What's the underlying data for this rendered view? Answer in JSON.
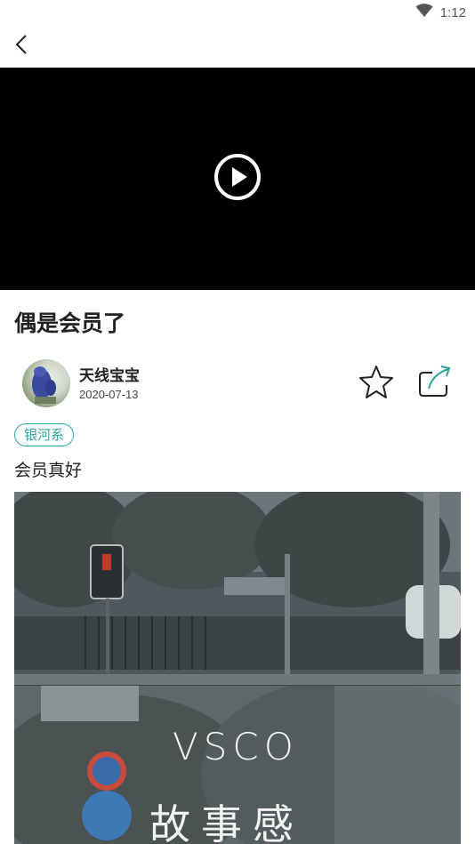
{
  "status_bar": {
    "time": "1:12",
    "wifi_icon": "wifi-icon"
  },
  "nav": {
    "back_icon": "back-arrow-icon"
  },
  "video": {
    "play_icon": "play-icon"
  },
  "post": {
    "title": "偶是会员了",
    "author_name": "天线宝宝",
    "date": "2020-07-13",
    "tag": "银河系",
    "body": "会员真好",
    "image_overlay": {
      "line1": "VSCO",
      "line2": "故事感"
    }
  },
  "actions": {
    "favorite_icon": "star-icon",
    "share_icon": "share-icon"
  },
  "colors": {
    "accent": "#2aa79b",
    "video_bg": "#000000"
  }
}
